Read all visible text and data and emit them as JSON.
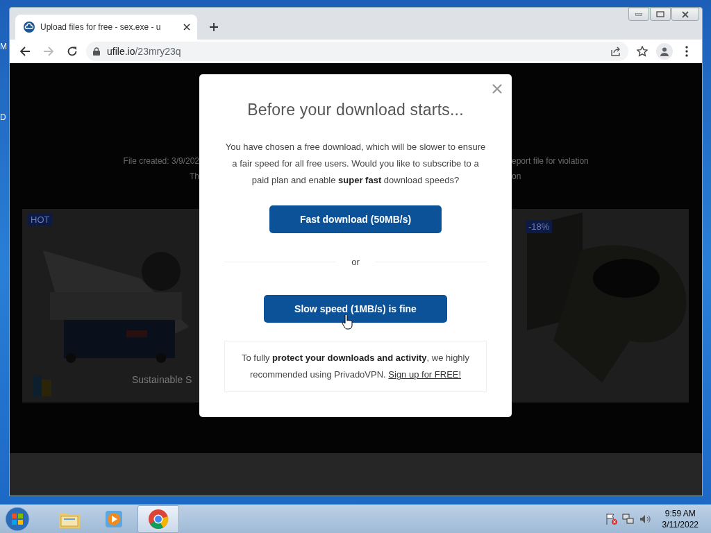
{
  "desktop": {
    "icon_labels": [
      "M",
      "D"
    ]
  },
  "browser": {
    "tabs": [
      {
        "title": "Upload files for free - sex.exe - u",
        "selected": true
      }
    ],
    "url": {
      "domain": "ufile.io",
      "path": "/23mry23q"
    }
  },
  "page": {
    "left_lines": [
      "File created: 3/9/202",
      "Th"
    ],
    "right_lines": [
      "eport file for violation",
      "on"
    ],
    "ads": [
      {
        "badge": "HOT",
        "caption": "Sustainable S",
        "kind": "machine"
      },
      {
        "badge": "-18%",
        "kind": "fixture"
      }
    ]
  },
  "modal": {
    "title": "Before your download starts...",
    "message": "You have chosen a free download, which will be slower to ensure a fair speed for all free users. Would you like to subscribe to a paid plan and enable **super fast** download speeds?",
    "primary_button": "Fast download (50MB/s)",
    "divider": "or",
    "secondary_button": "Slow speed (1MB/s) is fine",
    "vpn_note": "To fully **protect your downloads and activity**, we highly recommended using PrivadoVPN.",
    "vpn_link": "Sign up for FREE!"
  },
  "taskbar": {
    "items": [
      {
        "kind": "explorer",
        "selected": false
      },
      {
        "kind": "media",
        "selected": false
      },
      {
        "kind": "chrome",
        "selected": true
      }
    ],
    "time": "9:59 AM",
    "date": "3/11/2022"
  }
}
